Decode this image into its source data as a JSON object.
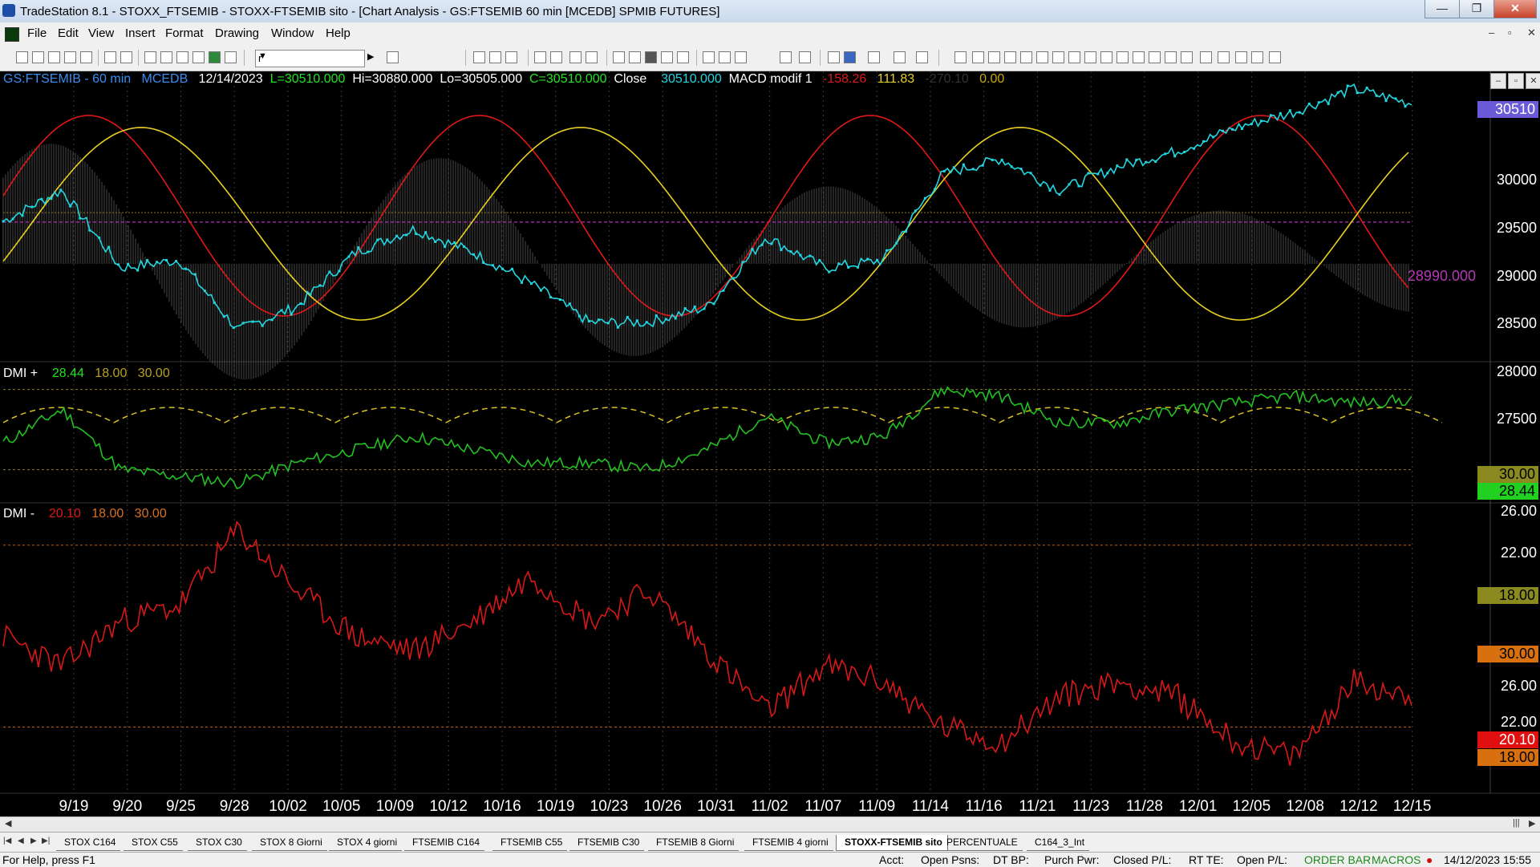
{
  "window": {
    "title": "TradeStation 8.1 - STOXX_FTSEMIB - STOXX-FTSEMIB sito - [Chart Analysis - GS:FTSEMIB  60 min  [MCEDB] SPMIB FUTURES]",
    "minimize": "—",
    "maximize": "❐",
    "close": "✕"
  },
  "menu": {
    "items": [
      "File",
      "Edit",
      "View",
      "Insert",
      "Format",
      "Drawing",
      "Window",
      "Help"
    ],
    "mdi": [
      "–",
      "▫",
      "✕"
    ]
  },
  "toolbar": {
    "combo_value": "r"
  },
  "chart": {
    "price_header": {
      "symbol": "GS:FTSEMIB - 60 min",
      "session": "MCEDB",
      "date": "12/14/2023",
      "last": "L=30510.000",
      "high": "Hi=30880.000",
      "low": "Lo=30505.000",
      "close": "C=30510.000",
      "close_label": "Close",
      "close_value": "30510.000",
      "indicator": "MACD modif 1",
      "macd1": "-158.26",
      "macd2": "111.83",
      "macd3": "-270.10",
      "macd4": "0.00"
    },
    "dmi_plus_header": {
      "name": "DMI +",
      "v1": "28.44",
      "v2": "18.00",
      "v3": "30.00"
    },
    "dmi_minus_header": {
      "name": "DMI -",
      "v1": "20.10",
      "v2": "18.00",
      "v3": "30.00"
    },
    "price_last_label": "30510",
    "ref_line_label": "28990.000",
    "price_axis": [
      "30000",
      "29500",
      "29000",
      "28500",
      "28000",
      "27500"
    ],
    "dmi_plus_axis": [
      "26.00",
      "22.00"
    ],
    "dmi_plus_labels": {
      "upper": "30.00",
      "value": "28.44",
      "lower": "18.00"
    },
    "dmi_minus_axis": [
      "26.00",
      "22.00"
    ],
    "dmi_minus_labels": {
      "upper": "30.00",
      "value": "20.10",
      "lower": "18.00"
    },
    "x_axis": [
      "9/19",
      "9/20",
      "9/25",
      "9/28",
      "10/02",
      "10/05",
      "10/09",
      "10/12",
      "10/16",
      "10/19",
      "10/23",
      "10/26",
      "10/31",
      "11/02",
      "11/07",
      "11/09",
      "11/14",
      "11/16",
      "11/21",
      "11/23",
      "11/28",
      "12/01",
      "12/05",
      "12/08",
      "12/12",
      "12/15"
    ],
    "colors": {
      "price": "#22d6e0",
      "macd_fast": "#e01818",
      "macd_slow": "#e8d020",
      "histogram": "#6a6a6a",
      "dmi_plus": "#22c022",
      "dmi_minus": "#d81818",
      "ref_line": "#9a2a9a"
    }
  },
  "chart_data": {
    "type": "line",
    "series": [
      {
        "name": "Close",
        "x": [
          "9/19",
          "9/20",
          "9/25",
          "9/28",
          "10/02",
          "10/05",
          "10/09",
          "10/12",
          "10/16",
          "10/19",
          "10/23",
          "10/26",
          "10/31",
          "11/02",
          "11/07",
          "11/09",
          "11/14",
          "11/16",
          "11/21",
          "11/23",
          "11/28",
          "12/01",
          "12/05",
          "12/08",
          "12/12"
        ],
        "values": [
          29000,
          29400,
          28400,
          28500,
          27600,
          27900,
          28600,
          28900,
          28600,
          28200,
          27700,
          27700,
          27900,
          28800,
          28400,
          28500,
          29600,
          29800,
          29400,
          29700,
          29900,
          30200,
          30400,
          30700,
          30510
        ]
      },
      {
        "name": "DMI +",
        "values": [
          22,
          27,
          18,
          17,
          16,
          19,
          21,
          23,
          21,
          19,
          19,
          18,
          21,
          26,
          22,
          23,
          30,
          29,
          25,
          25,
          27,
          28,
          29,
          28,
          28.44
        ]
      },
      {
        "name": "DMI -",
        "values": [
          24,
          22,
          25,
          26,
          31,
          27,
          24,
          23,
          25,
          28,
          25,
          27,
          23,
          19,
          22,
          21,
          18,
          17,
          20,
          21,
          20,
          17,
          16,
          21,
          20.1
        ]
      }
    ],
    "ylim_price": [
      27300,
      30800
    ],
    "ylim_dmi": [
      14,
      32
    ]
  },
  "tabs": {
    "nav": [
      "|◀",
      "◀",
      "▶",
      "▶|"
    ],
    "items": [
      "STOX C164",
      "STOX C55",
      "STOX  C30",
      "STOX  8 Giorni",
      "STOX 4 giorni",
      "FTSEMIB C164",
      "FTSEMIB C55",
      "FTSEMIB C30",
      "FTSEMIB  8 Giorni",
      "FTSEMIB  4 giorni",
      "STOXX-FTSEMIB sito",
      "PERCENTUALE",
      "C164_3_Int"
    ],
    "active": 10
  },
  "status": {
    "help": "For Help, press F1",
    "acct": "Acct:",
    "open_psns": "Open Psns:",
    "dt_bp": "DT BP:",
    "purch_pwr": "Purch Pwr:",
    "closed_pl": "Closed P/L:",
    "rt_te": "RT TE:",
    "open_pl": "Open P/L:",
    "order_bar": "ORDER BAR",
    "macros": "MACROS",
    "datetime": "14/12/2023 15:55"
  }
}
